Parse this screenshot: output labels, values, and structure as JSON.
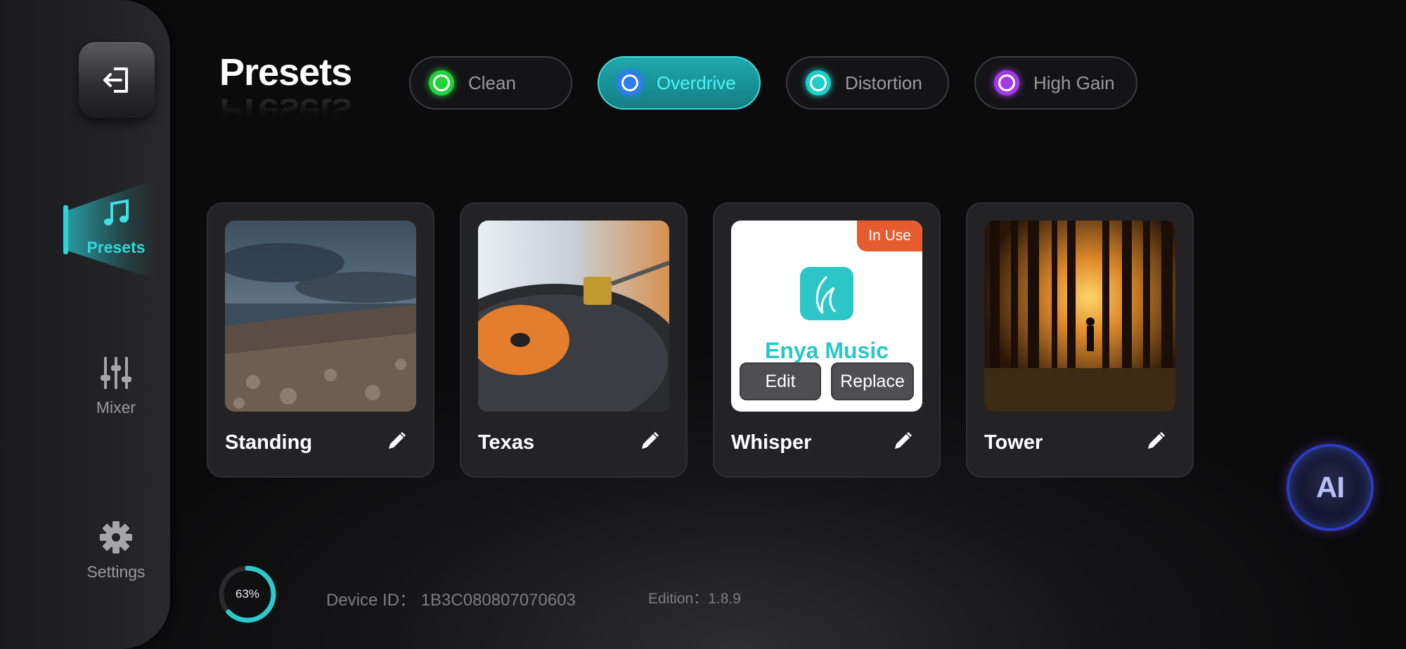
{
  "sidebar": {
    "items": [
      {
        "label": "Presets",
        "icon": "music-note-icon",
        "active": true
      },
      {
        "label": "Mixer",
        "icon": "sliders-icon",
        "active": false
      },
      {
        "label": "Settings",
        "icon": "gear-icon",
        "active": false
      }
    ]
  },
  "header": {
    "title": "Presets",
    "tabs": [
      {
        "label": "Clean",
        "color": "#22d23a",
        "active": false
      },
      {
        "label": "Overdrive",
        "color": "#2e7cf0",
        "active": true
      },
      {
        "label": "Distortion",
        "color": "#1ccfc9",
        "active": false
      },
      {
        "label": "High Gain",
        "color": "#a23be6",
        "active": false
      }
    ]
  },
  "presets": [
    {
      "name": "Standing"
    },
    {
      "name": "Texas"
    },
    {
      "name": "Whisper",
      "badge": "In Use",
      "logo_text": "Enya Music",
      "edit_label": "Edit",
      "replace_label": "Replace"
    },
    {
      "name": "Tower"
    }
  ],
  "footer": {
    "progress_percent": 63,
    "progress_label": "63%",
    "device_id": "Device ID： 1B3C080807070603",
    "edition": "Edition：1.8.9"
  },
  "ai_button": {
    "label": "AI"
  }
}
